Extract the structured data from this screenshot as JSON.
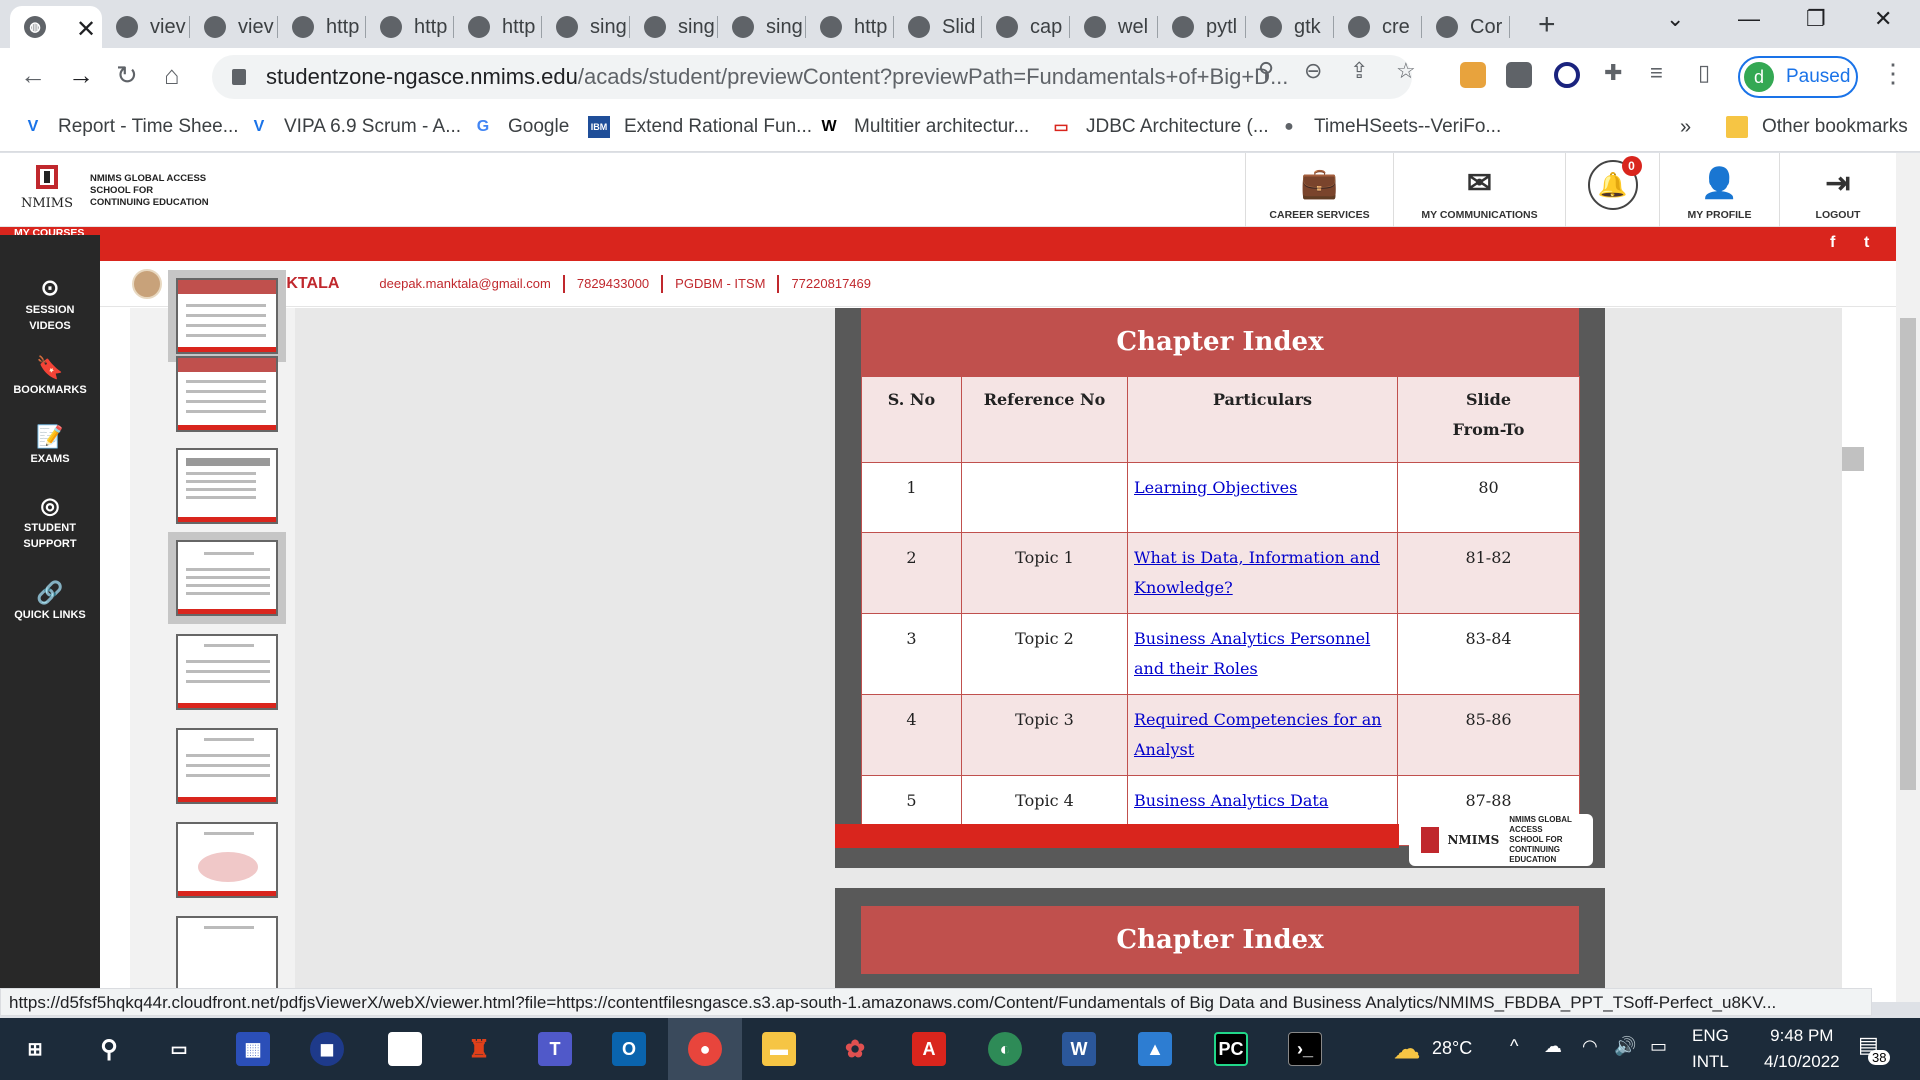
{
  "browser": {
    "tabs": [
      {
        "label": ""
      },
      {
        "label": "viev"
      },
      {
        "label": "viev"
      },
      {
        "label": "http"
      },
      {
        "label": "http"
      },
      {
        "label": "http"
      },
      {
        "label": "sing"
      },
      {
        "label": "sing"
      },
      {
        "label": "sing"
      },
      {
        "label": "http"
      },
      {
        "label": "Slid"
      },
      {
        "label": "cap"
      },
      {
        "label": "wel"
      },
      {
        "label": "pytl"
      },
      {
        "label": "gtk"
      },
      {
        "label": "cre"
      },
      {
        "label": "Cor"
      }
    ],
    "url_domain": "studentzone-ngasce.nmims.edu",
    "url_path": "/acads/student/previewContent?previewPath=Fundamentals+of+Big+D...",
    "profile_initial": "d",
    "profile_status": "Paused",
    "bookmarks": [
      {
        "label": "Report - Time Shee...",
        "icon": "V"
      },
      {
        "label": "VIPA 6.9 Scrum - A...",
        "icon": "V"
      },
      {
        "label": "Google",
        "icon": "G"
      },
      {
        "label": "Extend Rational Fun...",
        "icon": "IBM"
      },
      {
        "label": "Multitier architectur...",
        "icon": "W"
      },
      {
        "label": "JDBC Architecture (...",
        "icon": "▭"
      },
      {
        "label": "TimeHSeets--VeriFo...",
        "icon": "●"
      }
    ],
    "bookmarks_overflow": "»",
    "other_bookmarks": "Other bookmarks"
  },
  "site": {
    "logo_text_1": "NMIMS GLOBAL ACCESS",
    "logo_text_2": "SCHOOL FOR",
    "logo_text_3": "CONTINUING EDUCATION",
    "logo_word": "NMIMS",
    "header_items": [
      {
        "label": "CAREER SERVICES",
        "icon": "briefcase-icon"
      },
      {
        "label": "MY COMMUNICATIONS",
        "icon": "mail-icon"
      },
      {
        "label": "MY PROFILE",
        "icon": "user-icon"
      },
      {
        "label": "LOGOUT",
        "icon": "logout-icon"
      }
    ],
    "notification_count": "0",
    "my_courses": "MY COURSES",
    "social": [
      "f",
      "t"
    ],
    "sidebar": [
      {
        "label": "SESSION VIDEOS",
        "icon": "play-icon"
      },
      {
        "label": "BOOKMARKS",
        "icon": "bookmark-icon"
      },
      {
        "label": "EXAMS",
        "icon": "exam-icon"
      },
      {
        "label": "STUDENT SUPPORT",
        "icon": "support-icon"
      },
      {
        "label": "QUICK LINKS",
        "icon": "link-icon"
      }
    ],
    "user": {
      "name": "DEEPAK MANKTALA",
      "email": "deepak.manktala@gmail.com",
      "phone": "7829433000",
      "program": "PGDBM - ITSM",
      "id": "77220817469"
    }
  },
  "slide": {
    "title": "Chapter Index",
    "columns": [
      "S. No",
      "Reference No",
      "Particulars",
      "Slide From-To"
    ],
    "column_slide_line1": "Slide",
    "column_slide_line2": "From-To",
    "rows": [
      {
        "sno": "1",
        "ref": "",
        "particulars": "Learning Objectives",
        "slides": "80"
      },
      {
        "sno": "2",
        "ref": "Topic 1",
        "particulars": "What is Data, Information and Knowledge?",
        "slides": "81-82"
      },
      {
        "sno": "3",
        "ref": "Topic 2",
        "particulars": "Business Analytics Personnel and their Roles",
        "slides": "83-84"
      },
      {
        "sno": "4",
        "ref": "Topic 3",
        "particulars": "Required Competencies for an Analyst",
        "slides": "85-86"
      },
      {
        "sno": "5",
        "ref": "Topic 4",
        "particulars": "Business Analytics Data",
        "slides": "87-88"
      }
    ],
    "footer_logo_word": "NMIMS",
    "footer_logo_1": "NMIMS GLOBAL ACCESS",
    "footer_logo_2": "SCHOOL FOR",
    "footer_logo_3": "CONTINUING EDUCATION",
    "next_title": "Chapter Index"
  },
  "status_url": "https://d5fsf5hqkq44r.cloudfront.net/pdfjsViewerX/webX/viewer.html?file=https://contentfilesngasce.s3.ap-south-1.amazonaws.com/Content/Fundamentals of Big Data and Business Analytics/NMIMS_FBDBA_PPT_TSoff-Perfect_u8KV...",
  "taskbar": {
    "temperature": "28°C",
    "lang_1": "ENG",
    "lang_2": "INTL",
    "time": "9:48 PM",
    "date": "4/10/2022",
    "notification_count": "38"
  }
}
